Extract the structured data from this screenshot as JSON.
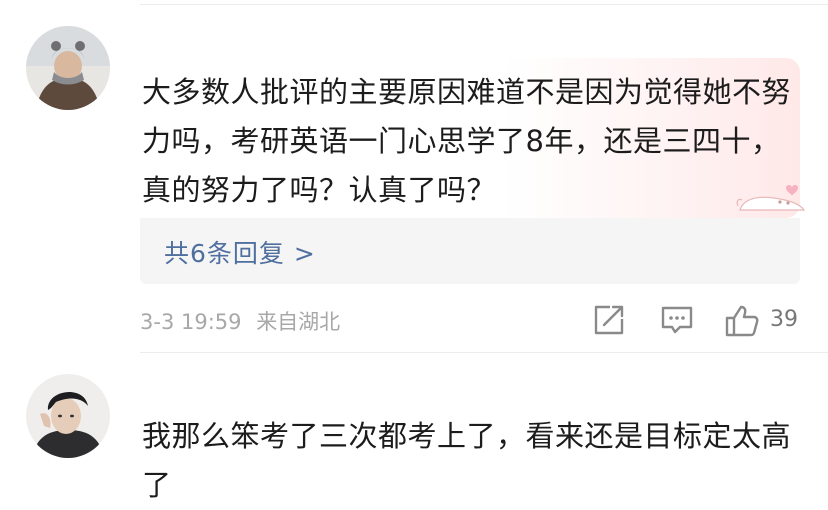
{
  "comments": [
    {
      "text": "大多数人批评的主要原因难道不是因为觉得她不努力吗，考研英语一门心思学了8年，还是三四十，真的努力了吗？认真了吗？",
      "replies_label": "共6条回复 >",
      "date": "3-3 19:59",
      "location": "来自湖北",
      "like_count": "39",
      "icons": [
        "share-icon",
        "comment-icon",
        "thumbs-up-icon"
      ]
    },
    {
      "text": "我那么笨考了三次都考上了，看来还是目标定太高了"
    }
  ]
}
